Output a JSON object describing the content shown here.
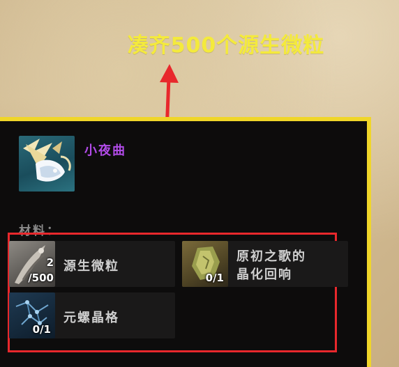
{
  "annotation": {
    "text": "凑齐500个源生微粒"
  },
  "item": {
    "name": "小夜曲",
    "icon": "serenade-weapon-icon"
  },
  "materials": {
    "label": "材料：",
    "items": [
      {
        "name": "源生微粒",
        "have": "2",
        "need": "/500",
        "icon": "primordial-particle-icon"
      },
      {
        "name_line1": "原初之歌的",
        "name_line2": "晶化回响",
        "count": "0/1",
        "icon": "primal-song-crystal-icon"
      },
      {
        "name": "元螺晶格",
        "count": "0/1",
        "icon": "helix-lattice-icon"
      }
    ]
  },
  "colors": {
    "annotation": "#f4ea3c",
    "arrow": "#e8282c",
    "panel_border": "#f0d629",
    "item_name": "#b14be8",
    "highlight_box": "#e8282c"
  }
}
